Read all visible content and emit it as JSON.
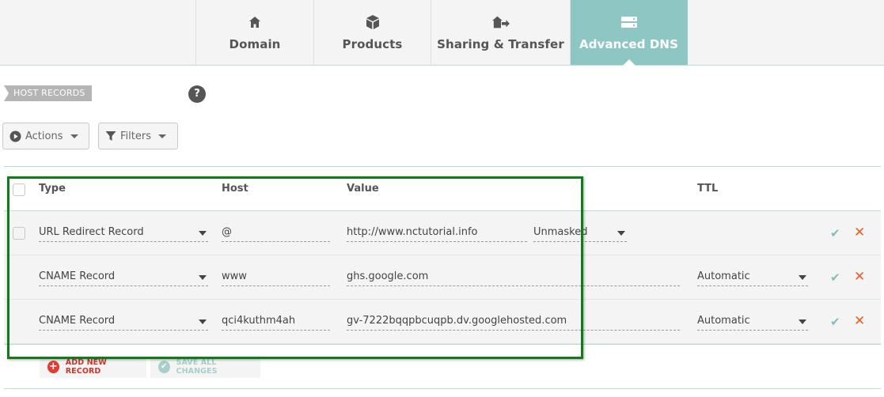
{
  "tabs": [
    {
      "label": "Domain",
      "icon": "home-icon"
    },
    {
      "label": "Products",
      "icon": "box-icon"
    },
    {
      "label": "Sharing & Transfer",
      "icon": "transfer-icon"
    },
    {
      "label": "Advanced DNS",
      "icon": "server-icon",
      "active": true
    }
  ],
  "section": {
    "title": "HOST RECORDS",
    "help": "?"
  },
  "toolbar": {
    "actions_label": "Actions",
    "filters_label": "Filters"
  },
  "table": {
    "headers": {
      "type": "Type",
      "host": "Host",
      "value": "Value",
      "ttl": "TTL"
    },
    "rows": [
      {
        "type": "URL Redirect Record",
        "host": "@",
        "value": "http://www.nctutorial.info",
        "mask": "Unmasked",
        "ttl": ""
      },
      {
        "type": "CNAME Record",
        "host": "www",
        "value": "ghs.google.com",
        "mask": "",
        "ttl": "Automatic"
      },
      {
        "type": "CNAME Record",
        "host": "qci4kuthm4ah",
        "value": "gv-7222bqqpbcuqpb.dv.googlehosted.com",
        "mask": "",
        "ttl": "Automatic"
      }
    ]
  },
  "footer": {
    "add_label": "ADD NEW RECORD",
    "save_label": "SAVE ALL CHANGES"
  },
  "colors": {
    "accent": "#8ec6c3",
    "delete": "#f15a22",
    "add": "#e03c31",
    "highlight": "#0f7b1a"
  }
}
